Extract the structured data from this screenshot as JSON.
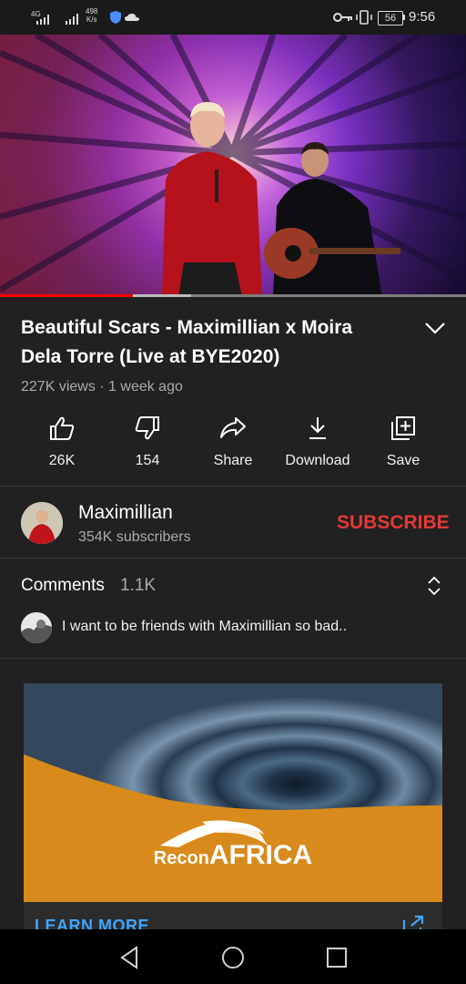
{
  "status_bar": {
    "network_top": "4G",
    "speed_value": "498",
    "speed_unit": "K/s",
    "battery": "56",
    "time": "9:56"
  },
  "video": {
    "progress": 0.285,
    "buffered": 0.41
  },
  "title": "Beautiful Scars - Maximillian x Moira Dela Torre (Live at BYE2020)",
  "meta": "227K views · 1 week ago",
  "actions": [
    {
      "icon": "thumbs-up-icon",
      "label": "26K"
    },
    {
      "icon": "thumbs-down-icon",
      "label": "154"
    },
    {
      "icon": "share-icon",
      "label": "Share"
    },
    {
      "icon": "download-icon",
      "label": "Download"
    },
    {
      "icon": "save-playlist-icon",
      "label": "Save"
    }
  ],
  "channel": {
    "name": "Maximillian",
    "subscribers": "354K subscribers",
    "subscribe_label": "SUBSCRIBE"
  },
  "comments": {
    "heading": "Comments",
    "count": "1.1K",
    "top_comment": "I want to be friends with Maximillian so bad.."
  },
  "ad": {
    "brand": "ReconAFRICA",
    "brand_part1": "Recon",
    "brand_part2": "AFRICA",
    "cta": "LEARN MORE"
  },
  "colors": {
    "background": "#212121",
    "accent_red": "#e53935",
    "progress": "#ff0000",
    "link_blue": "#3ea6ff",
    "ad_orange": "#d88a1c"
  }
}
